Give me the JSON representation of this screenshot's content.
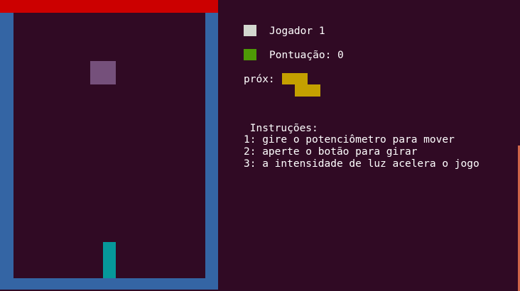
{
  "player": {
    "label": "Jogador 1",
    "swatch_color": "#d3d7cf"
  },
  "score": {
    "label": "Pontuação: 0",
    "swatch_color": "#4e9a06"
  },
  "next_piece": {
    "label": "próx:",
    "shape": "Z",
    "color": "#c4a000"
  },
  "instructions": {
    "title": " Instruções:",
    "lines": [
      "1: gire o potenciômetro para mover",
      "2: aperte o botão para girar",
      "3: a intensidade de luz acelera o jogo"
    ]
  },
  "colors": {
    "background": "#300a24",
    "top_bar": "#cc0000",
    "walls": "#3465a4",
    "falling_piece": "#75507b",
    "landed_piece": "#06989a"
  }
}
